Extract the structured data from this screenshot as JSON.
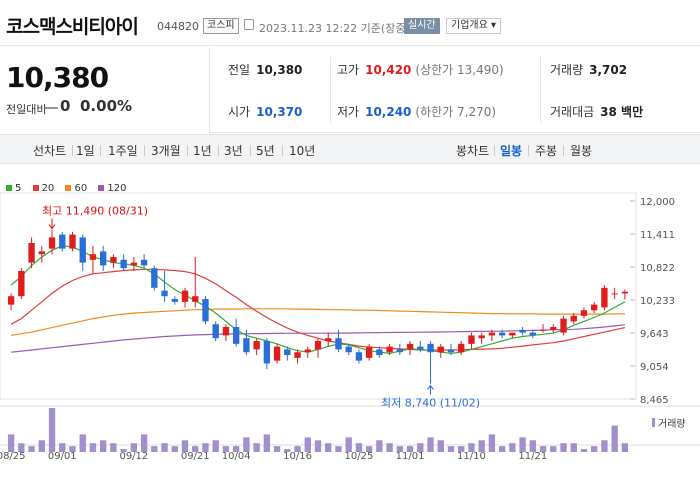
{
  "header": {
    "name": "코스맥스비티아이",
    "code": "044820",
    "market": "코스피",
    "timestamp": "2023.11.23 12:22  기준(장중)",
    "realtime_button": "실시간",
    "company_button": "기업개요 ▾"
  },
  "price": {
    "current": "10,380",
    "change_label": "전일대비",
    "change": "0",
    "change_pct": "0.00%"
  },
  "stats": {
    "prev_label": "전일",
    "prev": "10,380",
    "high_label": "고가",
    "high": "10,420",
    "upper_limit": "(상한가 13,490)",
    "volume_label": "거래량",
    "volume": "3,702",
    "open_label": "시가",
    "open": "10,370",
    "low_label": "저가",
    "low": "10,240",
    "lower_limit": "(하한가 7,270)",
    "amount_label": "거래대금",
    "amount": "38 백만"
  },
  "toolbar": {
    "line_label": "선차트",
    "periods": [
      "1일",
      "1주일",
      "3개월",
      "1년",
      "3년",
      "5년",
      "10년"
    ],
    "candle_label": "봉차트",
    "candles": [
      "일봉",
      "주봉",
      "월봉"
    ],
    "active_candle": "일봉"
  },
  "legend": [
    {
      "name": "5",
      "color": "#2fb02f"
    },
    {
      "name": "20",
      "color": "#e23c3c"
    },
    {
      "name": "60",
      "color": "#f08a1f"
    },
    {
      "name": "120",
      "color": "#9b59b6"
    }
  ],
  "chart_data": {
    "type": "candlestick",
    "y_ticks": [
      "12,000",
      "11,411",
      "10,822",
      "10,233",
      "9,643",
      "9,054",
      "8,465"
    ],
    "ylim": [
      8465,
      12000
    ],
    "x_labels": [
      "08/25",
      "09/01",
      "09/12",
      "09/21",
      "10/04",
      "10/16",
      "10/25",
      "11/01",
      "11/10",
      "11/21"
    ],
    "x_label_index": [
      0,
      5,
      12,
      18,
      22,
      28,
      34,
      39,
      45,
      51
    ],
    "annotations": {
      "high": "최고 11,490 (08/31)",
      "low": "최저 8,740 (11/02)"
    },
    "volume_label": "거래량",
    "candles": [
      {
        "o": 10150,
        "h": 10350,
        "l": 10050,
        "c": 10300
      },
      {
        "o": 10300,
        "h": 10800,
        "l": 10250,
        "c": 10750
      },
      {
        "o": 10900,
        "h": 11350,
        "l": 10800,
        "c": 11250
      },
      {
        "o": 11050,
        "h": 11200,
        "l": 10900,
        "c": 11100
      },
      {
        "o": 11150,
        "h": 11490,
        "l": 11050,
        "c": 11350
      },
      {
        "o": 11400,
        "h": 11450,
        "l": 11100,
        "c": 11150
      },
      {
        "o": 11150,
        "h": 11450,
        "l": 11100,
        "c": 11400
      },
      {
        "o": 11350,
        "h": 11400,
        "l": 10750,
        "c": 10900
      },
      {
        "o": 10950,
        "h": 11200,
        "l": 10700,
        "c": 11050
      },
      {
        "o": 11100,
        "h": 11200,
        "l": 10750,
        "c": 10850
      },
      {
        "o": 10900,
        "h": 11050,
        "l": 10800,
        "c": 11000
      },
      {
        "o": 10950,
        "h": 11050,
        "l": 10750,
        "c": 10800
      },
      {
        "o": 10850,
        "h": 11000,
        "l": 10750,
        "c": 10900
      },
      {
        "o": 10950,
        "h": 11050,
        "l": 10800,
        "c": 10850
      },
      {
        "o": 10800,
        "h": 10850,
        "l": 10400,
        "c": 10450
      },
      {
        "o": 10400,
        "h": 10750,
        "l": 10200,
        "c": 10300
      },
      {
        "o": 10250,
        "h": 10300,
        "l": 10150,
        "c": 10200
      },
      {
        "o": 10200,
        "h": 10450,
        "l": 10100,
        "c": 10400
      },
      {
        "o": 10200,
        "h": 11000,
        "l": 10100,
        "c": 10300
      },
      {
        "o": 10250,
        "h": 10300,
        "l": 9800,
        "c": 9850
      },
      {
        "o": 9800,
        "h": 9850,
        "l": 9500,
        "c": 9550
      },
      {
        "o": 9600,
        "h": 9800,
        "l": 9500,
        "c": 9750
      },
      {
        "o": 9750,
        "h": 9900,
        "l": 9400,
        "c": 9450
      },
      {
        "o": 9550,
        "h": 9700,
        "l": 9250,
        "c": 9300
      },
      {
        "o": 9350,
        "h": 9550,
        "l": 9250,
        "c": 9500
      },
      {
        "o": 9500,
        "h": 9550,
        "l": 9000,
        "c": 9100
      },
      {
        "o": 9150,
        "h": 9450,
        "l": 9100,
        "c": 9400
      },
      {
        "o": 9350,
        "h": 9400,
        "l": 9150,
        "c": 9250
      },
      {
        "o": 9200,
        "h": 9350,
        "l": 9100,
        "c": 9300
      },
      {
        "o": 9300,
        "h": 9400,
        "l": 9200,
        "c": 9350
      },
      {
        "o": 9350,
        "h": 9550,
        "l": 9200,
        "c": 9500
      },
      {
        "o": 9500,
        "h": 9650,
        "l": 9400,
        "c": 9550
      },
      {
        "o": 9550,
        "h": 9700,
        "l": 9300,
        "c": 9350
      },
      {
        "o": 9400,
        "h": 9450,
        "l": 9250,
        "c": 9300
      },
      {
        "o": 9300,
        "h": 9350,
        "l": 9100,
        "c": 9150
      },
      {
        "o": 9200,
        "h": 9450,
        "l": 9150,
        "c": 9400
      },
      {
        "o": 9350,
        "h": 9400,
        "l": 9200,
        "c": 9250
      },
      {
        "o": 9300,
        "h": 9450,
        "l": 9250,
        "c": 9400
      },
      {
        "o": 9350,
        "h": 9450,
        "l": 9250,
        "c": 9300
      },
      {
        "o": 9350,
        "h": 9500,
        "l": 9250,
        "c": 9450
      },
      {
        "o": 9400,
        "h": 9500,
        "l": 9300,
        "c": 9350
      },
      {
        "o": 9450,
        "h": 9500,
        "l": 8740,
        "c": 9300
      },
      {
        "o": 9300,
        "h": 9450,
        "l": 9200,
        "c": 9400
      },
      {
        "o": 9350,
        "h": 9450,
        "l": 9250,
        "c": 9300
      },
      {
        "o": 9300,
        "h": 9500,
        "l": 9250,
        "c": 9450
      },
      {
        "o": 9450,
        "h": 9650,
        "l": 9350,
        "c": 9600
      },
      {
        "o": 9550,
        "h": 9650,
        "l": 9450,
        "c": 9600
      },
      {
        "o": 9600,
        "h": 9700,
        "l": 9500,
        "c": 9650
      },
      {
        "o": 9650,
        "h": 9700,
        "l": 9550,
        "c": 9600
      },
      {
        "o": 9600,
        "h": 9650,
        "l": 9550,
        "c": 9650
      },
      {
        "o": 9700,
        "h": 9750,
        "l": 9600,
        "c": 9650
      },
      {
        "o": 9650,
        "h": 9700,
        "l": 9550,
        "c": 9600
      },
      {
        "o": 9700,
        "h": 9800,
        "l": 9650,
        "c": 9700
      },
      {
        "o": 9700,
        "h": 9800,
        "l": 9650,
        "c": 9750
      },
      {
        "o": 9650,
        "h": 9950,
        "l": 9600,
        "c": 9900
      },
      {
        "o": 9850,
        "h": 10000,
        "l": 9800,
        "c": 9950
      },
      {
        "o": 9950,
        "h": 10100,
        "l": 9900,
        "c": 10050
      },
      {
        "o": 10050,
        "h": 10200,
        "l": 10000,
        "c": 10150
      },
      {
        "o": 10100,
        "h": 10500,
        "l": 10050,
        "c": 10450
      },
      {
        "o": 10350,
        "h": 10450,
        "l": 10250,
        "c": 10350
      },
      {
        "o": 10350,
        "h": 10420,
        "l": 10240,
        "c": 10380
      }
    ],
    "volume": [
      6,
      3,
      2,
      4,
      15,
      3,
      2,
      6,
      3,
      4,
      3,
      1,
      3,
      6,
      2,
      3,
      2,
      4,
      2,
      3,
      4,
      2,
      2,
      5,
      3,
      6,
      2,
      1,
      2,
      5,
      4,
      3,
      2,
      5,
      3,
      2,
      4,
      3,
      2,
      2,
      3,
      5,
      4,
      2,
      2,
      3,
      4,
      6,
      2,
      3,
      5,
      4,
      2,
      2,
      3,
      3,
      1,
      2,
      4,
      9,
      3
    ],
    "ma": {
      "5": [
        10500,
        10650,
        10850,
        11000,
        11120,
        11200,
        11180,
        11100,
        11000,
        10950,
        10900,
        10880,
        10850,
        10800,
        10700,
        10550,
        10420,
        10320,
        10220,
        10120,
        10000,
        9850,
        9700,
        9600,
        9550,
        9500,
        9450,
        9380,
        9330,
        9300,
        9350,
        9400,
        9450,
        9430,
        9380,
        9330,
        9300,
        9280,
        9320,
        9360,
        9350,
        9330,
        9300,
        9280,
        9300,
        9350,
        9400,
        9450,
        9500,
        9550,
        9580,
        9600,
        9620,
        9640,
        9700,
        9780,
        9850,
        9920,
        10000,
        10100,
        10200
      ],
      "20": [
        9800,
        9900,
        10050,
        10200,
        10350,
        10480,
        10580,
        10650,
        10700,
        10720,
        10740,
        10760,
        10770,
        10780,
        10780,
        10770,
        10760,
        10740,
        10700,
        10620,
        10520,
        10400,
        10280,
        10150,
        10030,
        9920,
        9820,
        9730,
        9660,
        9600,
        9550,
        9500,
        9470,
        9440,
        9410,
        9390,
        9380,
        9370,
        9360,
        9350,
        9340,
        9340,
        9340,
        9340,
        9345,
        9350,
        9355,
        9360,
        9370,
        9390,
        9410,
        9430,
        9450,
        9470,
        9500,
        9540,
        9580,
        9620,
        9660,
        9700,
        9740
      ],
      "60": [
        9600,
        9630,
        9660,
        9700,
        9740,
        9780,
        9820,
        9860,
        9900,
        9930,
        9960,
        9980,
        10000,
        10010,
        10020,
        10030,
        10040,
        10050,
        10060,
        10060,
        10070,
        10070,
        10070,
        10075,
        10075,
        10075,
        10075,
        10075,
        10070,
        10070,
        10065,
        10060,
        10060,
        10055,
        10050,
        10050,
        10045,
        10040,
        10035,
        10030,
        10025,
        10020,
        10015,
        10010,
        10005,
        10000,
        9995,
        9990,
        9990,
        9985,
        9985,
        9985,
        9980,
        9980,
        9980,
        9980,
        9980,
        9980,
        9980,
        9985,
        9985
      ],
      "120": [
        9300,
        9320,
        9340,
        9360,
        9380,
        9400,
        9420,
        9440,
        9460,
        9480,
        9500,
        9520,
        9535,
        9550,
        9565,
        9580,
        9590,
        9600,
        9610,
        9615,
        9620,
        9625,
        9628,
        9630,
        9632,
        9634,
        9636,
        9638,
        9640,
        9640,
        9640,
        9640,
        9642,
        9644,
        9646,
        9648,
        9650,
        9652,
        9654,
        9656,
        9658,
        9660,
        9662,
        9665,
        9668,
        9670,
        9672,
        9674,
        9676,
        9680,
        9685,
        9690,
        9695,
        9700,
        9705,
        9710,
        9720,
        9735,
        9750,
        9770,
        9790
      ]
    }
  }
}
